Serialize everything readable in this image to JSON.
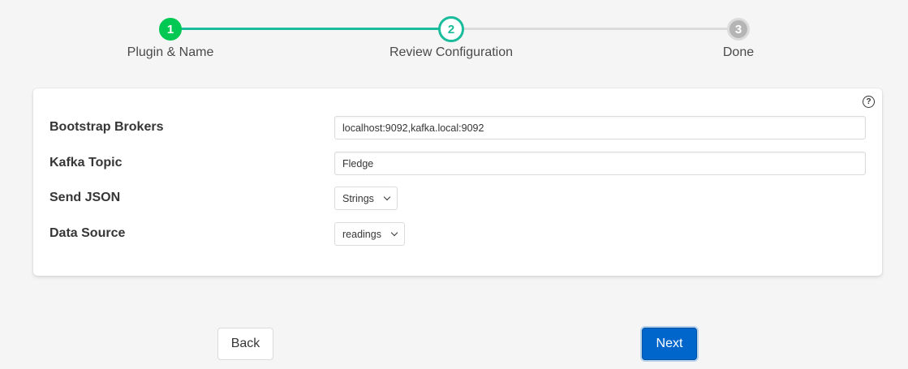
{
  "stepper": {
    "steps": [
      {
        "number": "1",
        "label": "Plugin & Name",
        "state": "completed"
      },
      {
        "number": "2",
        "label": "Review Configuration",
        "state": "active"
      },
      {
        "number": "3",
        "label": "Done",
        "state": "pending"
      }
    ],
    "colors": {
      "completed": "#00c853",
      "active": "#1abc9c",
      "pending": "#b5b5b5"
    }
  },
  "config": {
    "help_icon": "question-circle-icon",
    "help_glyph": "?",
    "fields": {
      "bootstrap_brokers": {
        "label": "Bootstrap Brokers",
        "value": "localhost:9092,kafka.local:9092"
      },
      "kafka_topic": {
        "label": "Kafka Topic",
        "value": "Fledge"
      },
      "send_json": {
        "label": "Send JSON",
        "selected": "Strings"
      },
      "data_source": {
        "label": "Data Source",
        "selected": "readings"
      }
    }
  },
  "actions": {
    "back_label": "Back",
    "next_label": "Next",
    "primary_color": "#0066cc"
  }
}
